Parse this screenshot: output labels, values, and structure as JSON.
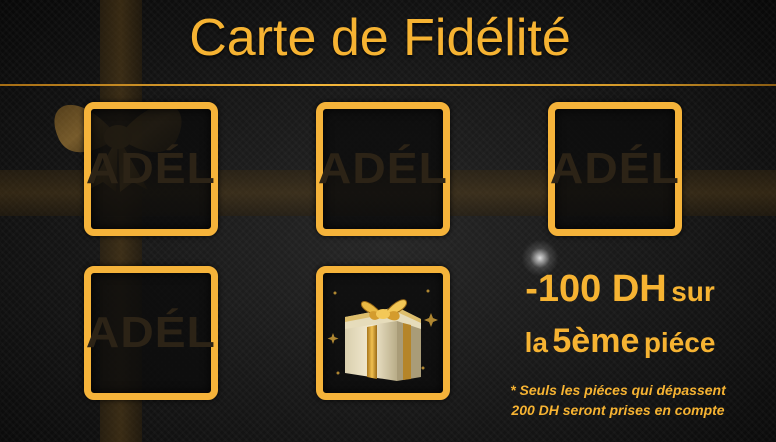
{
  "card": {
    "title": "Carte de Fidélité",
    "stamp_text": "ADÉL",
    "promo": {
      "amount": "-100 DH",
      "sur": "sur",
      "la": "la",
      "piece_number": "5ème",
      "piece_word": "piéce"
    },
    "note_line1": "* Seuls les piéces qui dépassent",
    "note_line2": "200 DH seront prises en compte"
  },
  "colors": {
    "gold": "#f5b33a",
    "background": "#141414"
  },
  "icons": {
    "gift": "gift-box-icon",
    "bow": "ribbon-bow-icon"
  }
}
